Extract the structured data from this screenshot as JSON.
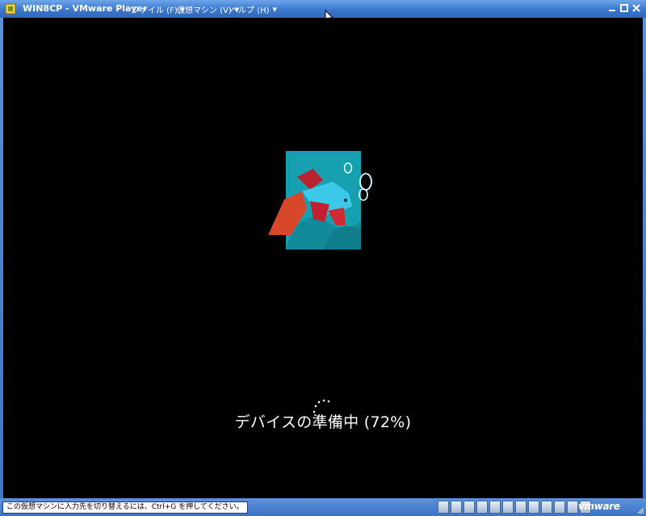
{
  "window": {
    "title": "WIN8CP - VMware Player",
    "menus": [
      {
        "label": "ファイル (F)"
      },
      {
        "label": "仮想マシン (V)"
      },
      {
        "label": "ヘルプ (H)"
      }
    ]
  },
  "guest": {
    "status_text": "デバイスの準備中 (72%)",
    "progress_percent": 72
  },
  "statusbar": {
    "message": "この仮想マシンに入力先を切り替えるには、Ctrl+G を押してください。",
    "brand": "vmware",
    "device_icons": [
      "hard-disk-icon",
      "cdrom-icon",
      "floppy-icon",
      "network-icon",
      "printer-icon",
      "usb-icon",
      "usb-icon",
      "usb-icon",
      "usb-icon",
      "display-icon",
      "display-icon",
      "message-icon"
    ]
  },
  "colors": {
    "title_bar": "#3e7bd0",
    "screen_bg": "#000000",
    "fish_bg": "#17a0b0"
  }
}
